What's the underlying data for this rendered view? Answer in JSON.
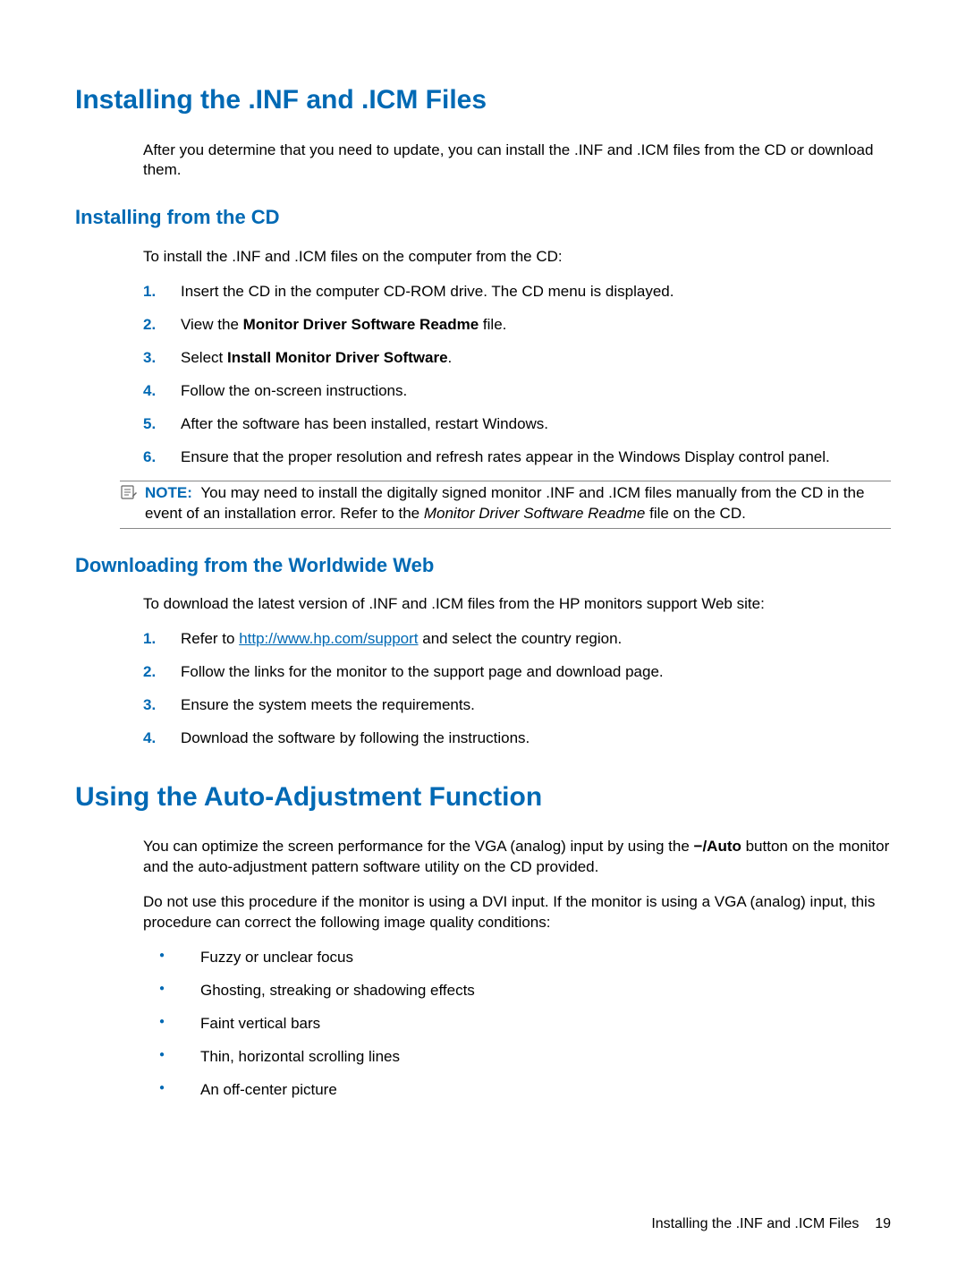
{
  "h1_1": "Installing the .INF and .ICM Files",
  "intro_1": "After you determine that you need to update, you can install the .INF and .ICM files from the CD or download them.",
  "h2_1": "Installing from the CD",
  "cd_intro": "To install the .INF and .ICM files on the computer from the CD:",
  "cd_steps": {
    "m1": "1.",
    "t1": "Insert the CD in the computer CD-ROM drive. The CD menu is displayed.",
    "m2": "2.",
    "t2_a": "View the ",
    "t2_b": "Monitor Driver Software Readme",
    "t2_c": " file.",
    "m3": "3.",
    "t3_a": "Select ",
    "t3_b": "Install Monitor Driver Software",
    "t3_c": ".",
    "m4": "4.",
    "t4": "Follow the on-screen instructions.",
    "m5": "5.",
    "t5": "After the software has been installed, restart Windows.",
    "m6": "6.",
    "t6": "Ensure that the proper resolution and refresh rates appear in the Windows Display control panel."
  },
  "note_label": "NOTE:",
  "note_a": "You may need to install the digitally signed monitor .INF and .ICM files manually from the CD in the event of an installation error. Refer to the ",
  "note_b": "Monitor Driver Software Readme",
  "note_c": " file on the CD.",
  "h2_2": "Downloading from the Worldwide Web",
  "dl_intro": "To download the latest version of .INF and .ICM files from the HP monitors support Web site:",
  "dl_steps": {
    "m1": "1.",
    "t1_a": "Refer to ",
    "t1_link": "http://www.hp.com/support",
    "t1_b": " and select the country region.",
    "m2": "2.",
    "t2": "Follow the links for the monitor to the support page and download page.",
    "m3": "3.",
    "t3": "Ensure the system meets the requirements.",
    "m4": "4.",
    "t4": "Download the software by following the instructions."
  },
  "h1_2": "Using the Auto-Adjustment Function",
  "auto_p1_a": "You can optimize the screen performance for the VGA (analog) input by using the ",
  "auto_p1_b": "−/Auto",
  "auto_p1_c": " button on the monitor and the auto-adjustment pattern software utility on the CD provided.",
  "auto_p2": "Do not use this procedure if the monitor is using a DVI input. If the monitor is using a VGA (analog) input, this procedure can correct the following image quality conditions:",
  "bullets": {
    "b1": "Fuzzy or unclear focus",
    "b2": "Ghosting, streaking or shadowing effects",
    "b3": "Faint vertical bars",
    "b4": "Thin, horizontal scrolling lines",
    "b5": "An off-center picture"
  },
  "footer_text": "Installing the .INF and .ICM Files",
  "footer_page": "19"
}
